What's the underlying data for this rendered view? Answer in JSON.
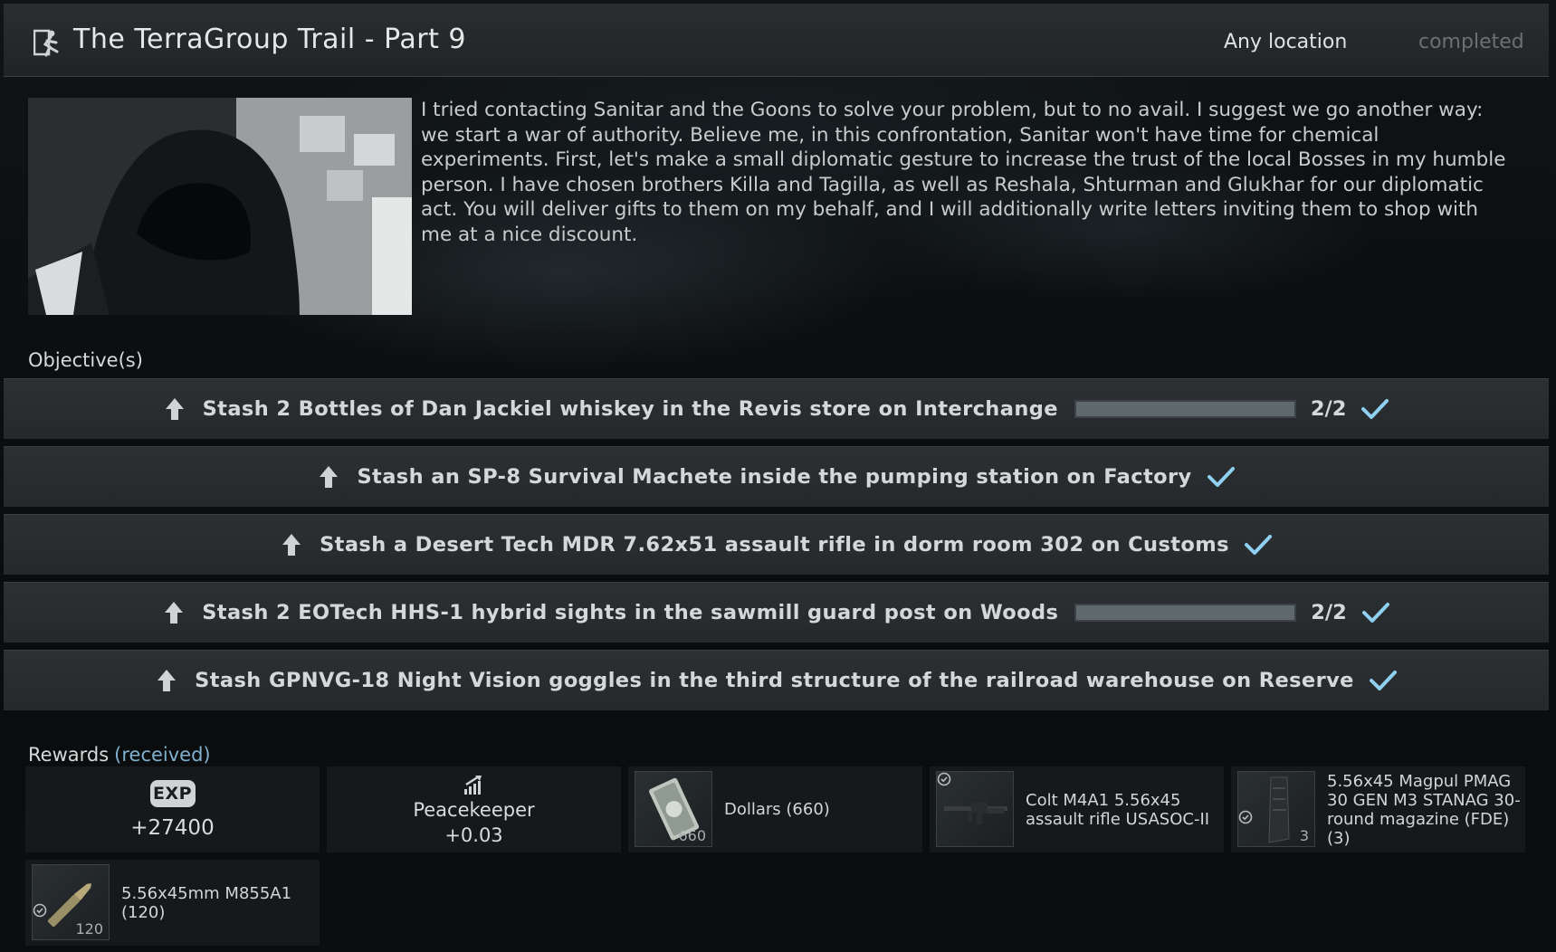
{
  "header": {
    "title": "The TerraGroup Trail - Part 9",
    "location": "Any location",
    "status": "completed"
  },
  "description": "I tried contacting Sanitar and the Goons to solve your problem, but to no avail. I suggest we go another way: we start a war of authority. Believe me, in this confrontation, Sanitar won't have time for chemical experiments. First, let's make a small diplomatic gesture to increase the trust of the local Bosses in my humble person. I have chosen brothers Killa and Tagilla, as well as Reshala, Shturman and Glukhar for our diplomatic act. You will deliver gifts to them on my behalf, and I will additionally write letters inviting them to shop with me at a nice discount.",
  "objectives_label": "Objective(s)",
  "objectives": [
    {
      "text": "Stash 2 Bottles of Dan Jackiel whiskey in the Revis store on Interchange",
      "progress": "2/2",
      "progress_fraction": 1.0
    },
    {
      "text": "Stash an SP-8 Survival Machete inside the pumping station on Factory"
    },
    {
      "text": "Stash a Desert Tech MDR 7.62x51 assault rifle in dorm room 302 on Customs"
    },
    {
      "text": "Stash 2 EOTech HHS-1 hybrid sights in the sawmill guard post on Woods",
      "progress": "2/2",
      "progress_fraction": 1.0
    },
    {
      "text": "Stash GPNVG-18 Night Vision goggles in the third structure of the railroad warehouse on Reserve"
    }
  ],
  "rewards_label": "Rewards",
  "rewards_status": "(received)",
  "rewards": {
    "exp_badge": "EXP",
    "exp_value": "+27400",
    "rep_trader": "Peacekeeper",
    "rep_value": "+0.03",
    "dollars_label": "Dollars (660)",
    "dollars_count": "660",
    "rifle_label": "Colt M4A1 5.56x45 assault rifle USASOC-II",
    "magazine_label": "5.56x45 Magpul PMAG 30 GEN M3 STANAG 30-round magazine (FDE) (3)",
    "magazine_count": "3",
    "ammo_label": "5.56x45mm M855A1 (120)",
    "ammo_count": "120"
  },
  "colors": {
    "accent_check": "#8fd0f0",
    "received": "#7fb0cf",
    "status_completed": "#6b7072"
  }
}
